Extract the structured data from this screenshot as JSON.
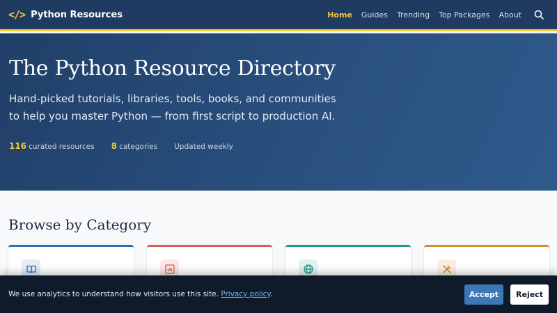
{
  "nav": {
    "brand_icon": "</>",
    "brand_name": "Python Resources",
    "links": [
      {
        "label": "Home",
        "active": true
      },
      {
        "label": "Guides",
        "active": false
      },
      {
        "label": "Trending",
        "active": false
      },
      {
        "label": "Top Packages",
        "active": false
      },
      {
        "label": "About",
        "active": false
      }
    ],
    "search_icon": "search-icon"
  },
  "hero": {
    "title": "The Python Resource Directory",
    "subtitle": "Hand-picked tutorials, libraries, tools, books, and communities to help you master Python — from first script to production AI.",
    "stats": [
      {
        "num": "116",
        "label": "curated resources"
      },
      {
        "num": "8",
        "label": "categories"
      },
      {
        "num": "",
        "label": "Updated weekly"
      }
    ]
  },
  "categories": {
    "title": "Browse by Category",
    "cards": [
      {
        "icon": "book-icon",
        "accent": "#2e6db0",
        "tint": "#e4edf7",
        "icon_color": "#2e6db0"
      },
      {
        "icon": "chart-icon",
        "accent": "#d9604a",
        "tint": "#fbe9e5",
        "icon_color": "#d9604a"
      },
      {
        "icon": "globe-icon",
        "accent": "#1f9a8a",
        "tint": "#e1f3f0",
        "icon_color": "#1f9a8a"
      },
      {
        "icon": "tools-icon",
        "accent": "#d98a2b",
        "tint": "#fbefe0",
        "icon_color": "#c47a22"
      }
    ]
  },
  "cookie": {
    "text": "We use analytics to understand how visitors use this site.",
    "link": "Privacy policy",
    "period": ".",
    "accept": "Accept",
    "reject": "Reject"
  },
  "colors": {
    "nav_bg": "#1f3b61",
    "accent_yellow": "#f2c935",
    "hero_bg": "#2a5180",
    "banner_bg": "#0f1b2a",
    "accept_bg": "#3c78b8"
  }
}
